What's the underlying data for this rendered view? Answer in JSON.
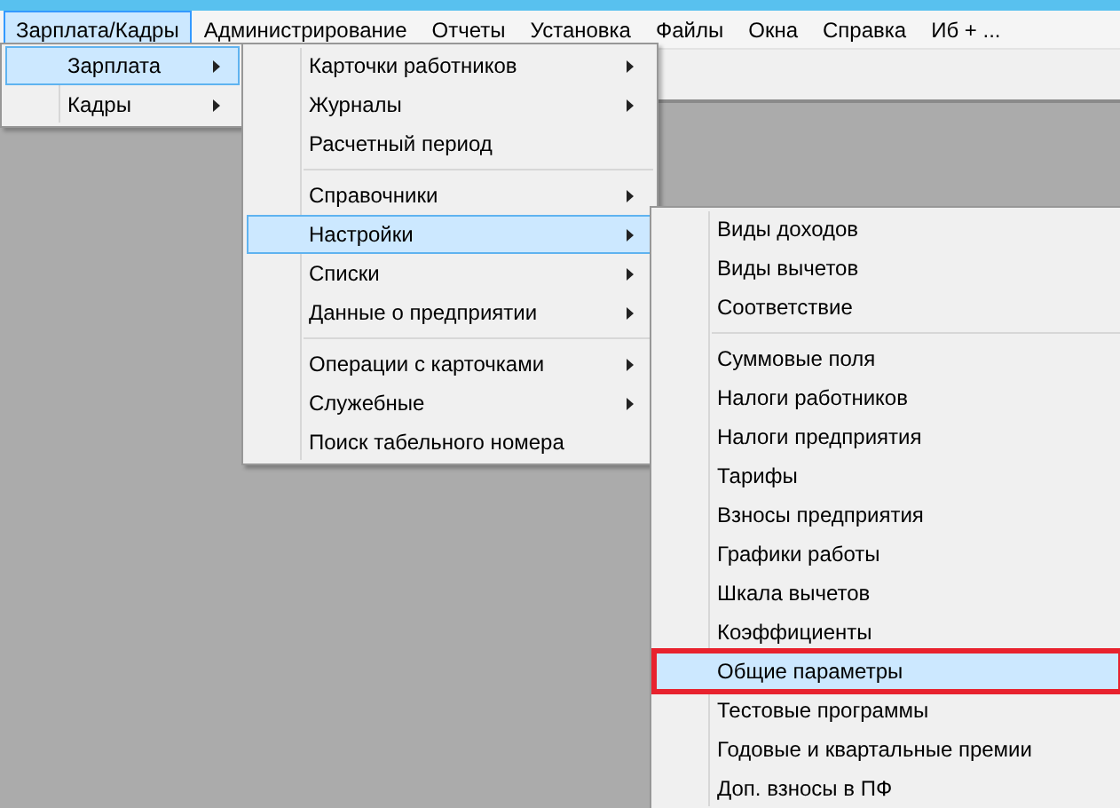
{
  "menubar": [
    {
      "label": "Зарплата/Кадры",
      "selected": true
    },
    {
      "label": "Администрирование",
      "selected": false
    },
    {
      "label": "Отчеты",
      "selected": false
    },
    {
      "label": "Установка",
      "selected": false
    },
    {
      "label": "Файлы",
      "selected": false
    },
    {
      "label": "Окна",
      "selected": false
    },
    {
      "label": "Справка",
      "selected": false
    },
    {
      "label": "Иб + ...",
      "selected": false
    }
  ],
  "menus": [
    {
      "items": [
        {
          "kind": "item",
          "label": "Зарплата",
          "selected": true,
          "submenu": true,
          "outlined": false
        },
        {
          "kind": "item",
          "label": "Кадры",
          "selected": false,
          "submenu": true,
          "outlined": false
        }
      ]
    },
    {
      "items": [
        {
          "kind": "item",
          "label": "Карточки работников",
          "selected": false,
          "submenu": true,
          "outlined": false
        },
        {
          "kind": "item",
          "label": "Журналы",
          "selected": false,
          "submenu": true,
          "outlined": false
        },
        {
          "kind": "item",
          "label": "Расчетный период",
          "selected": false,
          "submenu": false,
          "outlined": false
        },
        {
          "kind": "separator"
        },
        {
          "kind": "item",
          "label": "Справочники",
          "selected": false,
          "submenu": true,
          "outlined": false
        },
        {
          "kind": "item",
          "label": "Настройки",
          "selected": true,
          "submenu": true,
          "outlined": false
        },
        {
          "kind": "item",
          "label": "Списки",
          "selected": false,
          "submenu": true,
          "outlined": false
        },
        {
          "kind": "item",
          "label": "Данные о предприятии",
          "selected": false,
          "submenu": true,
          "outlined": false
        },
        {
          "kind": "separator"
        },
        {
          "kind": "item",
          "label": "Операции с карточками",
          "selected": false,
          "submenu": true,
          "outlined": false
        },
        {
          "kind": "item",
          "label": "Служебные",
          "selected": false,
          "submenu": true,
          "outlined": false
        },
        {
          "kind": "item",
          "label": "Поиск табельного номера",
          "selected": false,
          "submenu": false,
          "outlined": false
        }
      ]
    },
    {
      "items": [
        {
          "kind": "item",
          "label": "Виды доходов",
          "selected": false,
          "submenu": false,
          "outlined": false
        },
        {
          "kind": "item",
          "label": "Виды вычетов",
          "selected": false,
          "submenu": false,
          "outlined": false
        },
        {
          "kind": "item",
          "label": "Соответствие",
          "selected": false,
          "submenu": false,
          "outlined": false
        },
        {
          "kind": "separator"
        },
        {
          "kind": "item",
          "label": "Суммовые поля",
          "selected": false,
          "submenu": false,
          "outlined": false
        },
        {
          "kind": "item",
          "label": "Налоги работников",
          "selected": false,
          "submenu": false,
          "outlined": false
        },
        {
          "kind": "item",
          "label": "Налоги предприятия",
          "selected": false,
          "submenu": false,
          "outlined": false
        },
        {
          "kind": "item",
          "label": "Тарифы",
          "selected": false,
          "submenu": false,
          "outlined": false
        },
        {
          "kind": "item",
          "label": "Взносы предприятия",
          "selected": false,
          "submenu": false,
          "outlined": false
        },
        {
          "kind": "item",
          "label": "Графики работы",
          "selected": false,
          "submenu": false,
          "outlined": false
        },
        {
          "kind": "item",
          "label": "Шкала вычетов",
          "selected": false,
          "submenu": false,
          "outlined": false
        },
        {
          "kind": "item",
          "label": "Коэффициенты",
          "selected": false,
          "submenu": false,
          "outlined": false
        },
        {
          "kind": "item",
          "label": "Общие параметры",
          "selected": true,
          "submenu": false,
          "outlined": true
        },
        {
          "kind": "item",
          "label": "Тестовые программы",
          "selected": false,
          "submenu": false,
          "outlined": false
        },
        {
          "kind": "item",
          "label": "Годовые и квартальные премии",
          "selected": false,
          "submenu": false,
          "outlined": false
        },
        {
          "kind": "item",
          "label": "Доп. взносы в ПФ",
          "selected": false,
          "submenu": false,
          "outlined": false
        }
      ]
    }
  ]
}
